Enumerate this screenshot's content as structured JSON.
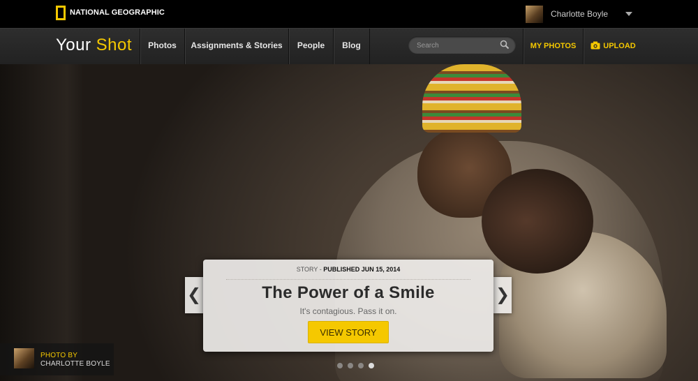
{
  "header": {
    "logo_text": "NATIONAL GEOGRAPHIC",
    "user_name": "Charlotte Boyle",
    "brand_your": "Your",
    "brand_shot": "Shot"
  },
  "nav": {
    "items": [
      {
        "label": "Photos"
      },
      {
        "label": "Assignments & Stories"
      },
      {
        "label": "People"
      },
      {
        "label": "Blog"
      }
    ],
    "search_placeholder": "Search",
    "my_photos": "MY PHOTOS",
    "upload": "UPLOAD"
  },
  "hero": {
    "story_type": "STORY -",
    "published": "PUBLISHED JUN 15, 2014",
    "title": "The Power of a Smile",
    "subtitle": "It's contagious. Pass it on.",
    "cta": "VIEW STORY",
    "prev_arrow": "❮",
    "next_arrow": "❯",
    "credit_label": "PHOTO BY",
    "credit_name": "CHARLOTTE BOYLE",
    "slide_count": 4,
    "active_slide": 4
  },
  "colors": {
    "accent": "#f5c800",
    "topbar": "#000000",
    "navbar": "#262626"
  }
}
